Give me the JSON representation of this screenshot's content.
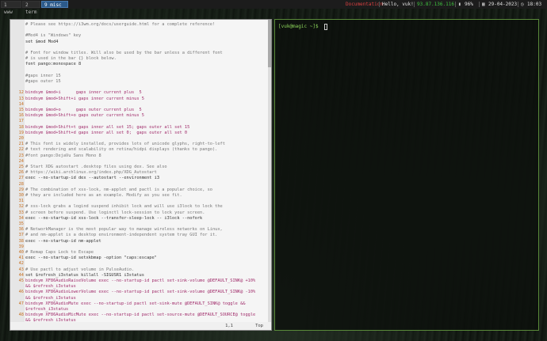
{
  "bar": {
    "workspaces": [
      "1 www",
      "2 term",
      "9 misc"
    ],
    "active_workspace": "9 misc",
    "status": {
      "documentation": "Documentation",
      "greeting": "Hello, vuk!",
      "ip": "93.87.136.116",
      "battery": "96%",
      "date": "29-04-2023",
      "time": "18:03"
    },
    "colors": {
      "documentation": "#d84040",
      "greeting": "#e0e0e0",
      "ip": "#3fc23f",
      "active_ws": "#2c5a8a"
    }
  },
  "editor": {
    "lines": [
      {
        "n": "",
        "t": "# Please see https://i3wm.org/docs/userguide.html for a complete reference!",
        "c": "comment"
      },
      {
        "n": "",
        "t": "",
        "c": ""
      },
      {
        "n": "",
        "t": "#Mod4 is \"Windows\" key",
        "c": "comment"
      },
      {
        "n": "",
        "t": "set $mod Mod4",
        "c": ""
      },
      {
        "n": "",
        "t": "",
        "c": ""
      },
      {
        "n": "",
        "t": "# Font for window titles. Will also be used by the bar unless a different font",
        "c": "comment"
      },
      {
        "n": "",
        "t": "# is used in the bar {} block below.",
        "c": "comment"
      },
      {
        "n": "",
        "t": "font pango:monospace 8",
        "c": ""
      },
      {
        "n": "",
        "t": "",
        "c": ""
      },
      {
        "n": "",
        "t": "#gaps inner 15",
        "c": "comment"
      },
      {
        "n": "",
        "t": "#gaps outer 15",
        "c": "comment"
      },
      {
        "n": "",
        "t": "",
        "c": ""
      },
      {
        "n": "12",
        "t": "bindsym $mod+i      gaps inner current plus  5",
        "c": "kw"
      },
      {
        "n": "13",
        "t": "bindsym $mod+Shift+i gaps inner current minus 5",
        "c": "kw"
      },
      {
        "n": "14",
        "t": "",
        "c": ""
      },
      {
        "n": "15",
        "t": "bindsym $mod+o      gaps outer current plus  5",
        "c": "kw"
      },
      {
        "n": "16",
        "t": "bindsym $mod+Shift+o gaps outer current minus 5",
        "c": "kw"
      },
      {
        "n": "17",
        "t": "",
        "c": ""
      },
      {
        "n": "18",
        "t": "bindsym $mod+Shift+t gaps inner all set 15; gaps outer all set 15",
        "c": "kw"
      },
      {
        "n": "19",
        "t": "bindsym $mod+Shift+d gaps inner all set 0;  gaps outer all set 0",
        "c": "kw"
      },
      {
        "n": "20",
        "t": "",
        "c": ""
      },
      {
        "n": "21",
        "t": "# This font is widely installed, provides lots of unicode glyphs, right-to-left",
        "c": "comment"
      },
      {
        "n": "22",
        "t": "# text rendering and scalability on retina/hidpi displays (thanks to pango).",
        "c": "comment"
      },
      {
        "n": "23",
        "t": "#font pango:DejaVu Sans Mono 8",
        "c": "comment"
      },
      {
        "n": "24",
        "t": "",
        "c": ""
      },
      {
        "n": "25",
        "t": "# Start XDG autostart .desktop files using dex. See also",
        "c": "comment"
      },
      {
        "n": "26",
        "t": "# https://wiki.archlinux.org/index.php/XDG_Autostart",
        "c": "comment"
      },
      {
        "n": "27",
        "t": "exec --no-startup-id dex --autostart --environment i3",
        "c": ""
      },
      {
        "n": "28",
        "t": "",
        "c": ""
      },
      {
        "n": "29",
        "t": "# The combination of xss-lock, nm-applet and pactl is a popular choice, so",
        "c": "comment"
      },
      {
        "n": "30",
        "t": "# they are included here as an example. Modify as you see fit.",
        "c": "comment"
      },
      {
        "n": "31",
        "t": "",
        "c": ""
      },
      {
        "n": "32",
        "t": "# xss-lock grabs a logind suspend inhibit lock and will use i3lock to lock the",
        "c": "comment"
      },
      {
        "n": "33",
        "t": "# screen before suspend. Use loginctl lock-session to lock your screen.",
        "c": "comment"
      },
      {
        "n": "34",
        "t": "exec --no-startup-id xss-lock --transfer-sleep-lock -- i3lock --nofork",
        "c": ""
      },
      {
        "n": "35",
        "t": "",
        "c": ""
      },
      {
        "n": "36",
        "t": "# NetworkManager is the most popular way to manage wireless networks on Linux,",
        "c": "comment"
      },
      {
        "n": "37",
        "t": "# and nm-applet is a desktop environment-independent system tray GUI for it.",
        "c": "comment"
      },
      {
        "n": "38",
        "t": "exec --no-startup-id nm-applet",
        "c": ""
      },
      {
        "n": "39",
        "t": "",
        "c": ""
      },
      {
        "n": "40",
        "t": "# Remap Caps Lock to Escape",
        "c": "comment"
      },
      {
        "n": "41",
        "t": "exec --no-startup-id setxkbmap -option \"caps:escape\"",
        "c": ""
      },
      {
        "n": "42",
        "t": "",
        "c": ""
      },
      {
        "n": "43",
        "t": "# Use pactl to adjust volume in PulseAudio.",
        "c": "comment"
      },
      {
        "n": "44",
        "t": "set $refresh_i3status killall -SIGUSR1 i3status",
        "c": ""
      },
      {
        "n": "45",
        "t": "bindsym XF86AudioRaiseVolume exec --no-startup-id pactl set-sink-volume @DEFAULT_SINK@ +10%",
        "c": "kw"
      },
      {
        "n": "",
        "t": "&& $refresh_i3status",
        "c": "kw"
      },
      {
        "n": "46",
        "t": "bindsym XF86AudioLowerVolume exec --no-startup-id pactl set-sink-volume @DEFAULT_SINK@ -10%",
        "c": "kw"
      },
      {
        "n": "",
        "t": "&& $refresh_i3status",
        "c": "kw"
      },
      {
        "n": "47",
        "t": "bindsym XF86AudioMute exec --no-startup-id pactl set-sink-mute @DEFAULT_SINK@ toggle &&",
        "c": "kw"
      },
      {
        "n": "",
        "t": "$refresh_i3status",
        "c": "kw"
      },
      {
        "n": "48",
        "t": "bindsym XF86AudioMicMute exec --no-startup-id pactl set-source-mute @DEFAULT_SOURCE@ toggle",
        "c": "kw"
      },
      {
        "n": "",
        "t": "&& $refresh_i3status",
        "c": "kw"
      }
    ],
    "cursor_pos": "1,1",
    "scroll_pct": "Top"
  },
  "terminal": {
    "prompt": "[vuk@magic ~]$"
  }
}
